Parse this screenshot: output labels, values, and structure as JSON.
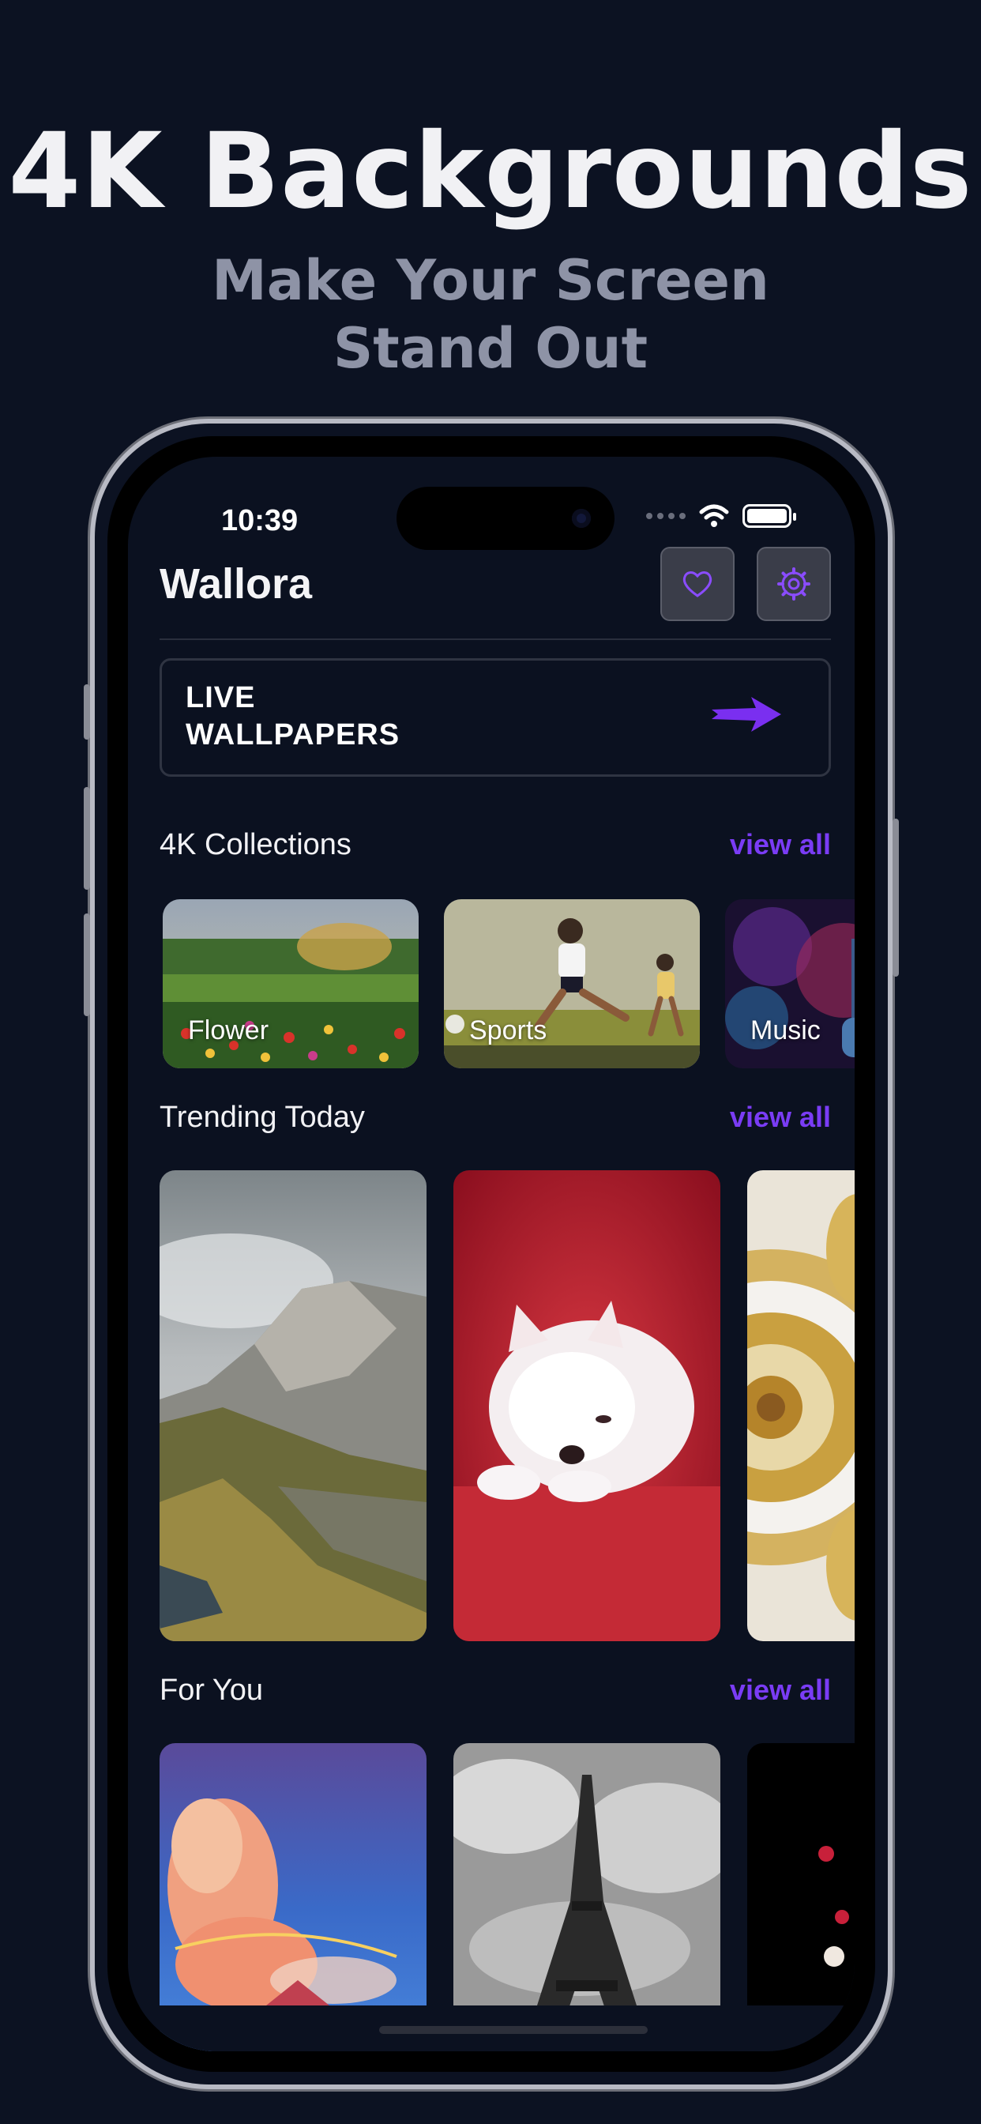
{
  "promo": {
    "title": "4K Backgrounds",
    "subtitle_line1": "Make Your Screen",
    "subtitle_line2": "Stand Out"
  },
  "status_bar": {
    "time": "10:39"
  },
  "app": {
    "title": "Wallora",
    "favorites_icon": "heart-icon",
    "settings_icon": "gear-icon"
  },
  "live_wallpapers": {
    "line1": "LIVE",
    "line2": "WALLPAPERS",
    "arrow_icon": "arrow-right-icon"
  },
  "sections": {
    "collections": {
      "title": "4K Collections",
      "link": "view all"
    },
    "trending": {
      "title": "Trending Today",
      "link": "view all"
    },
    "for_you": {
      "title": "For You",
      "link": "view all"
    }
  },
  "collections": [
    {
      "label": "Flower"
    },
    {
      "label": "Sports"
    },
    {
      "label": "Music"
    }
  ],
  "colors": {
    "background": "#0b1120",
    "accent": "#7a3cf5",
    "card_border": "#2f3442"
  }
}
